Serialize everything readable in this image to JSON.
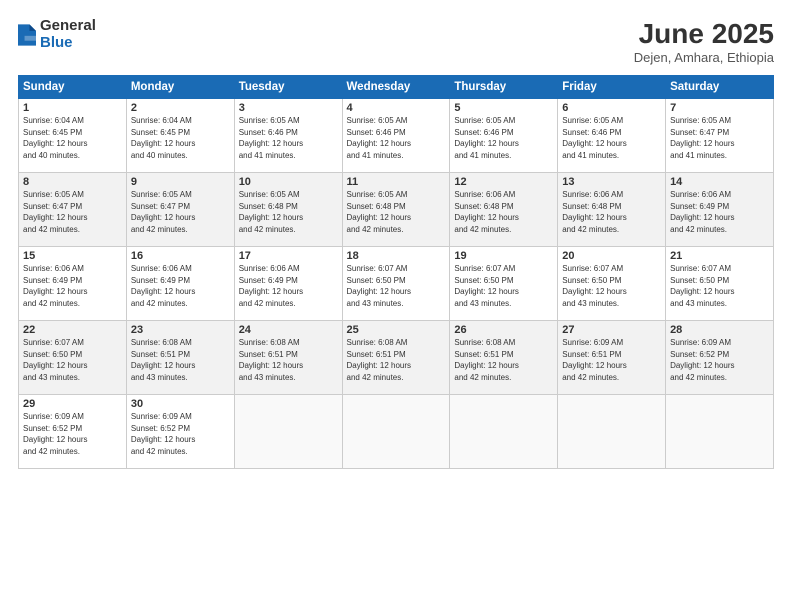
{
  "logo": {
    "general": "General",
    "blue": "Blue"
  },
  "title": "June 2025",
  "subtitle": "Dejen, Amhara, Ethiopia",
  "days_header": [
    "Sunday",
    "Monday",
    "Tuesday",
    "Wednesday",
    "Thursday",
    "Friday",
    "Saturday"
  ],
  "weeks": [
    [
      {
        "num": "1",
        "rise": "6:04 AM",
        "set": "6:45 PM",
        "hours": "12 hours",
        "mins": "40"
      },
      {
        "num": "2",
        "rise": "6:04 AM",
        "set": "6:45 PM",
        "hours": "12 hours",
        "mins": "40"
      },
      {
        "num": "3",
        "rise": "6:05 AM",
        "set": "6:46 PM",
        "hours": "12 hours",
        "mins": "41"
      },
      {
        "num": "4",
        "rise": "6:05 AM",
        "set": "6:46 PM",
        "hours": "12 hours",
        "mins": "41"
      },
      {
        "num": "5",
        "rise": "6:05 AM",
        "set": "6:46 PM",
        "hours": "12 hours",
        "mins": "41"
      },
      {
        "num": "6",
        "rise": "6:05 AM",
        "set": "6:46 PM",
        "hours": "12 hours",
        "mins": "41"
      },
      {
        "num": "7",
        "rise": "6:05 AM",
        "set": "6:47 PM",
        "hours": "12 hours",
        "mins": "41"
      }
    ],
    [
      {
        "num": "8",
        "rise": "6:05 AM",
        "set": "6:47 PM",
        "hours": "12 hours",
        "mins": "42"
      },
      {
        "num": "9",
        "rise": "6:05 AM",
        "set": "6:47 PM",
        "hours": "12 hours",
        "mins": "42"
      },
      {
        "num": "10",
        "rise": "6:05 AM",
        "set": "6:48 PM",
        "hours": "12 hours",
        "mins": "42"
      },
      {
        "num": "11",
        "rise": "6:05 AM",
        "set": "6:48 PM",
        "hours": "12 hours",
        "mins": "42"
      },
      {
        "num": "12",
        "rise": "6:06 AM",
        "set": "6:48 PM",
        "hours": "12 hours",
        "mins": "42"
      },
      {
        "num": "13",
        "rise": "6:06 AM",
        "set": "6:48 PM",
        "hours": "12 hours",
        "mins": "42"
      },
      {
        "num": "14",
        "rise": "6:06 AM",
        "set": "6:49 PM",
        "hours": "12 hours",
        "mins": "42"
      }
    ],
    [
      {
        "num": "15",
        "rise": "6:06 AM",
        "set": "6:49 PM",
        "hours": "12 hours",
        "mins": "42"
      },
      {
        "num": "16",
        "rise": "6:06 AM",
        "set": "6:49 PM",
        "hours": "12 hours",
        "mins": "42"
      },
      {
        "num": "17",
        "rise": "6:06 AM",
        "set": "6:49 PM",
        "hours": "12 hours",
        "mins": "42"
      },
      {
        "num": "18",
        "rise": "6:07 AM",
        "set": "6:50 PM",
        "hours": "12 hours",
        "mins": "43"
      },
      {
        "num": "19",
        "rise": "6:07 AM",
        "set": "6:50 PM",
        "hours": "12 hours",
        "mins": "43"
      },
      {
        "num": "20",
        "rise": "6:07 AM",
        "set": "6:50 PM",
        "hours": "12 hours",
        "mins": "43"
      },
      {
        "num": "21",
        "rise": "6:07 AM",
        "set": "6:50 PM",
        "hours": "12 hours",
        "mins": "43"
      }
    ],
    [
      {
        "num": "22",
        "rise": "6:07 AM",
        "set": "6:50 PM",
        "hours": "12 hours",
        "mins": "43"
      },
      {
        "num": "23",
        "rise": "6:08 AM",
        "set": "6:51 PM",
        "hours": "12 hours",
        "mins": "43"
      },
      {
        "num": "24",
        "rise": "6:08 AM",
        "set": "6:51 PM",
        "hours": "12 hours",
        "mins": "43"
      },
      {
        "num": "25",
        "rise": "6:08 AM",
        "set": "6:51 PM",
        "hours": "12 hours",
        "mins": "42"
      },
      {
        "num": "26",
        "rise": "6:08 AM",
        "set": "6:51 PM",
        "hours": "12 hours",
        "mins": "42"
      },
      {
        "num": "27",
        "rise": "6:09 AM",
        "set": "6:51 PM",
        "hours": "12 hours",
        "mins": "42"
      },
      {
        "num": "28",
        "rise": "6:09 AM",
        "set": "6:52 PM",
        "hours": "12 hours",
        "mins": "42"
      }
    ],
    [
      {
        "num": "29",
        "rise": "6:09 AM",
        "set": "6:52 PM",
        "hours": "12 hours",
        "mins": "42"
      },
      {
        "num": "30",
        "rise": "6:09 AM",
        "set": "6:52 PM",
        "hours": "12 hours",
        "mins": "42"
      },
      null,
      null,
      null,
      null,
      null
    ]
  ]
}
